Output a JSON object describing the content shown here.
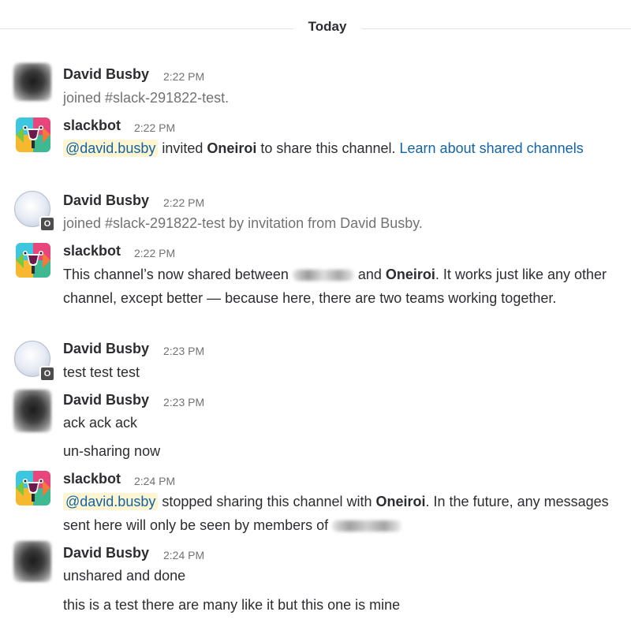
{
  "divider": {
    "label": "Today"
  },
  "users": {
    "david": "David Busby",
    "slackbot": "slackbot"
  },
  "messages": [
    {
      "time": "2:22 PM",
      "text": "joined #slack-291822-test."
    },
    {
      "time": "2:22 PM",
      "mention": "@david.busby",
      "text_a": " invited ",
      "bold": "Oneiroi",
      "text_b": " to share this channel. ",
      "link": "Learn about shared channels"
    },
    {
      "time": "2:22 PM",
      "text": "joined #slack-291822-test by invitation from David Busby.",
      "badge": "O"
    },
    {
      "time": "2:22 PM",
      "text_a": "This channel’s now shared between ",
      "text_b": " and ",
      "bold": "Oneiroi",
      "text_c": ". It works just like any other channel, except better — because here, there are two teams working together."
    },
    {
      "time": "2:23 PM",
      "text": "test test test",
      "badge": "O"
    },
    {
      "time": "2:23 PM",
      "lines": [
        "ack ack ack",
        "un-sharing now"
      ]
    },
    {
      "time": "2:24 PM",
      "mention": "@david.busby",
      "text_a": " stopped sharing this channel with ",
      "bold": "Oneiroi",
      "text_b": ". In the future, any messages sent here will only be seen by members of "
    },
    {
      "time": "2:24 PM",
      "lines": [
        "unshared and done",
        "this is a test there are many like it but this one is mine"
      ]
    }
  ],
  "icons": {
    "slackbot": "slackbot-avatar-icon",
    "guest": "guest-user-icon",
    "human": "user-avatar"
  }
}
